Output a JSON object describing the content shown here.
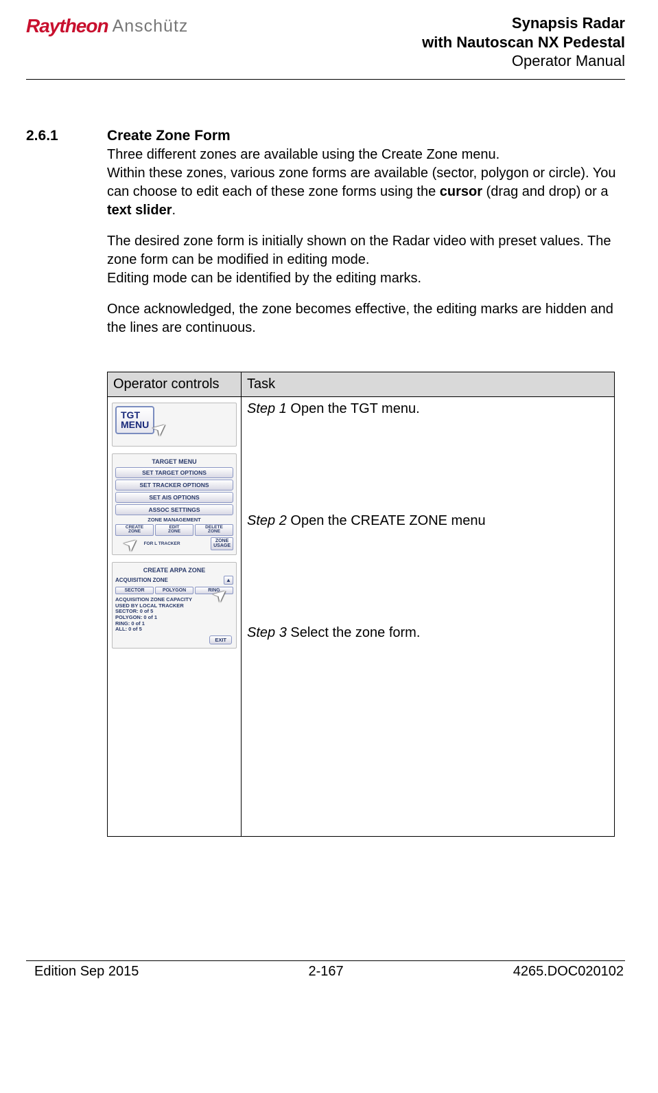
{
  "header": {
    "logo_primary": "Raytheon",
    "logo_secondary": "Anschütz",
    "title_line1": "Synapsis Radar",
    "title_line2": "with Nautoscan NX Pedestal",
    "title_line3": "Operator Manual"
  },
  "section": {
    "number": "2.6.1",
    "title": "Create Zone Form"
  },
  "paragraphs": {
    "p1a": "Three different zones are available using the Create Zone menu.",
    "p1b_pre": "Within these zones, various zone forms are available (sector, polygon or circle). You can choose to edit each of these zone forms using the ",
    "p1b_bold1": "cursor",
    "p1b_mid": " (drag and drop) or a ",
    "p1b_bold2": "text slider",
    "p1b_post": ".",
    "p2": "The desired zone form is initially shown on the Radar video with preset values. The zone form can be modified in editing mode.",
    "p2b": "Editing mode can be identified by the editing marks.",
    "p3": "Once acknowledged, the zone becomes effective, the editing marks are hidden and the lines are continuous."
  },
  "table": {
    "header_controls": "Operator controls",
    "header_task": "Task",
    "step1_label": "Step 1",
    "step1_text": " Open the TGT menu.",
    "step2_label": "Step 2",
    "step2_text": " Open the CREATE ZONE menu",
    "step3_label": "Step 3",
    "step3_text": " Select the zone form."
  },
  "ui": {
    "tgt_menu_line1": "TGT",
    "tgt_menu_line2": "MENU",
    "panel2": {
      "title": "TARGET MENU",
      "btn1": "SET TARGET OPTIONS",
      "btn2": "SET TRACKER OPTIONS",
      "btn3": "SET AIS OPTIONS",
      "btn4": "ASSOC SETTINGS",
      "subtitle": "ZONE MANAGEMENT",
      "create_l1": "CREATE",
      "create_l2": "ZONE",
      "edit_l1": "EDIT",
      "edit_l2": "ZONE",
      "delete_l1": "DELETE",
      "delete_l2": "ZONE",
      "for_tracker": "FOR    L  TRACKER",
      "zone_usage_l1": "ZONE",
      "zone_usage_l2": "USAGE"
    },
    "panel3": {
      "title": "CREATE ARPA ZONE",
      "acq": "ACQUISITION ZONE",
      "sector": "SECTOR",
      "polygon": "POLYGON",
      "ring": "RING",
      "caps_title": "ACQUISITION ZONE CAPACITY",
      "caps_sub": "USED BY LOCAL TRACKER",
      "caps_sector": "SECTOR: 0 of 5",
      "caps_polygon": "POLYGON: 0 of 1",
      "caps_ring": "RING: 0 of 1",
      "caps_all": "ALL: 0 of 5",
      "exit": "EXIT",
      "spin": "▲"
    }
  },
  "footer": {
    "left": "Edition Sep 2015",
    "center": "2-167",
    "right": "4265.DOC020102"
  }
}
